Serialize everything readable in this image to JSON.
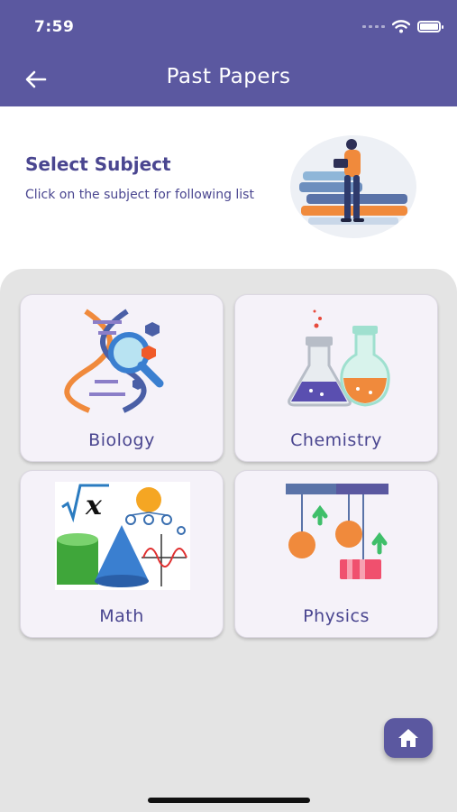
{
  "status_bar": {
    "time": "7:59"
  },
  "header": {
    "title": "Past Papers"
  },
  "intro": {
    "title": "Select Subject",
    "subtitle": "Click on the subject for following list"
  },
  "subjects": [
    {
      "label": "Biology",
      "icon": "dna-magnifier-icon"
    },
    {
      "label": "Chemistry",
      "icon": "flasks-icon"
    },
    {
      "label": "Math",
      "icon": "math-collage-icon"
    },
    {
      "label": "Physics",
      "icon": "pendulum-physics-icon"
    }
  ],
  "colors": {
    "primary": "#5b58a0",
    "text_accent": "#4a4690",
    "panel_bg": "#e4e4e4",
    "card_bg": "#f5f2f9"
  }
}
